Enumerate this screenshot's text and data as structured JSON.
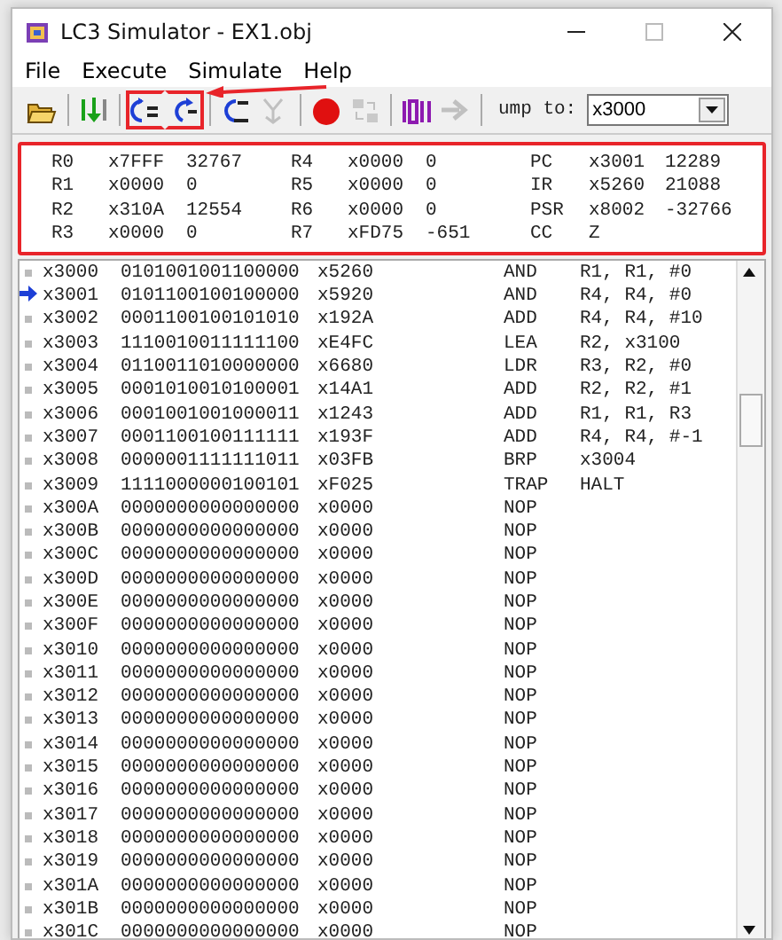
{
  "window": {
    "title": "LC3 Simulator - EX1.obj"
  },
  "menu": [
    "File",
    "Execute",
    "Simulate",
    "Help"
  ],
  "toolbar": {
    "buttons": [
      {
        "kind": "open",
        "disabled": false,
        "highlighted": false
      },
      {
        "kind": "run",
        "disabled": false,
        "highlighted": false
      },
      {
        "kind": "step-over",
        "disabled": false,
        "highlighted": true
      },
      {
        "kind": "step-into",
        "disabled": false,
        "highlighted": true
      },
      {
        "kind": "step-out",
        "disabled": false,
        "highlighted": false
      },
      {
        "kind": "back",
        "disabled": true,
        "highlighted": false
      },
      {
        "kind": "breakpoint",
        "disabled": false,
        "highlighted": false
      },
      {
        "kind": "watch",
        "disabled": true,
        "highlighted": false
      },
      {
        "kind": "memory",
        "disabled": false,
        "highlighted": false
      },
      {
        "kind": "go",
        "disabled": true,
        "highlighted": false
      }
    ],
    "jump_label": "ump to:",
    "jump_value": "x3000"
  },
  "registers": {
    "highlighted": true,
    "items": [
      {
        "name": "R0",
        "hex": "x7FFF",
        "decimal": "32767"
      },
      {
        "name": "R4",
        "hex": "x0000",
        "decimal": "0"
      },
      {
        "name": "PC",
        "hex": "x3001",
        "decimal": "12289"
      },
      {
        "name": "R1",
        "hex": "x0000",
        "decimal": "0"
      },
      {
        "name": "R5",
        "hex": "x0000",
        "decimal": "0"
      },
      {
        "name": "IR",
        "hex": "x5260",
        "decimal": "21088"
      },
      {
        "name": "R2",
        "hex": "x310A",
        "decimal": "12554"
      },
      {
        "name": "R6",
        "hex": "x0000",
        "decimal": "0"
      },
      {
        "name": "PSR",
        "hex": "x8002",
        "decimal": "-32766"
      },
      {
        "name": "R3",
        "hex": "x0000",
        "decimal": "0"
      },
      {
        "name": "R7",
        "hex": "xFD75",
        "decimal": "-651"
      },
      {
        "name": "CC",
        "hex": "Z"
      }
    ]
  },
  "memory": {
    "rows": [
      {
        "address": "x3000",
        "binary": "0101001001100000",
        "hex": "x5260",
        "opcode": "AND",
        "operands": "R1, R1, #0",
        "current": false
      },
      {
        "address": "x3001",
        "binary": "0101100100100000",
        "hex": "x5920",
        "opcode": "AND",
        "operands": "R4, R4, #0",
        "current": true
      },
      {
        "address": "x3002",
        "binary": "0001100100101010",
        "hex": "x192A",
        "opcode": "ADD",
        "operands": "R4, R4, #10",
        "current": false
      },
      {
        "address": "x3003",
        "binary": "1110010011111100",
        "hex": "xE4FC",
        "opcode": "LEA",
        "operands": "R2, x3100",
        "current": false
      },
      {
        "address": "x3004",
        "binary": "0110011010000000",
        "hex": "x6680",
        "opcode": "LDR",
        "operands": "R3, R2, #0",
        "current": false
      },
      {
        "address": "x3005",
        "binary": "0001010010100001",
        "hex": "x14A1",
        "opcode": "ADD",
        "operands": "R2, R2, #1",
        "current": false
      },
      {
        "address": "x3006",
        "binary": "0001001001000011",
        "hex": "x1243",
        "opcode": "ADD",
        "operands": "R1, R1, R3",
        "current": false
      },
      {
        "address": "x3007",
        "binary": "0001100100111111",
        "hex": "x193F",
        "opcode": "ADD",
        "operands": "R4, R4, #-1",
        "current": false
      },
      {
        "address": "x3008",
        "binary": "0000001111111011",
        "hex": "x03FB",
        "opcode": "BRP",
        "operands": "x3004",
        "current": false
      },
      {
        "address": "x3009",
        "binary": "1111000000100101",
        "hex": "xF025",
        "opcode": "TRAP",
        "operands": "HALT",
        "current": false
      },
      {
        "address": "x300A",
        "binary": "0000000000000000",
        "hex": "x0000",
        "opcode": "NOP",
        "current": false
      },
      {
        "address": "x300B",
        "binary": "0000000000000000",
        "hex": "x0000",
        "opcode": "NOP",
        "current": false
      },
      {
        "address": "x300C",
        "binary": "0000000000000000",
        "hex": "x0000",
        "opcode": "NOP",
        "current": false
      },
      {
        "address": "x300D",
        "binary": "0000000000000000",
        "hex": "x0000",
        "opcode": "NOP",
        "current": false
      },
      {
        "address": "x300E",
        "binary": "0000000000000000",
        "hex": "x0000",
        "opcode": "NOP",
        "current": false
      },
      {
        "address": "x300F",
        "binary": "0000000000000000",
        "hex": "x0000",
        "opcode": "NOP",
        "current": false
      },
      {
        "address": "x3010",
        "binary": "0000000000000000",
        "hex": "x0000",
        "opcode": "NOP",
        "current": false
      },
      {
        "address": "x3011",
        "binary": "0000000000000000",
        "hex": "x0000",
        "opcode": "NOP",
        "current": false
      },
      {
        "address": "x3012",
        "binary": "0000000000000000",
        "hex": "x0000",
        "opcode": "NOP",
        "current": false
      },
      {
        "address": "x3013",
        "binary": "0000000000000000",
        "hex": "x0000",
        "opcode": "NOP",
        "current": false
      },
      {
        "address": "x3014",
        "binary": "0000000000000000",
        "hex": "x0000",
        "opcode": "NOP",
        "current": false
      },
      {
        "address": "x3015",
        "binary": "0000000000000000",
        "hex": "x0000",
        "opcode": "NOP",
        "current": false
      },
      {
        "address": "x3016",
        "binary": "0000000000000000",
        "hex": "x0000",
        "opcode": "NOP",
        "current": false
      },
      {
        "address": "x3017",
        "binary": "0000000000000000",
        "hex": "x0000",
        "opcode": "NOP",
        "current": false
      },
      {
        "address": "x3018",
        "binary": "0000000000000000",
        "hex": "x0000",
        "opcode": "NOP",
        "current": false
      },
      {
        "address": "x3019",
        "binary": "0000000000000000",
        "hex": "x0000",
        "opcode": "NOP",
        "current": false
      },
      {
        "address": "x301A",
        "binary": "0000000000000000",
        "hex": "x0000",
        "opcode": "NOP",
        "current": false
      },
      {
        "address": "x301B",
        "binary": "0000000000000000",
        "hex": "x0000",
        "opcode": "NOP",
        "current": false
      },
      {
        "address": "x301C",
        "binary": "0000000000000000",
        "hex": "x0000",
        "opcode": "NOP",
        "current": false
      }
    ]
  }
}
